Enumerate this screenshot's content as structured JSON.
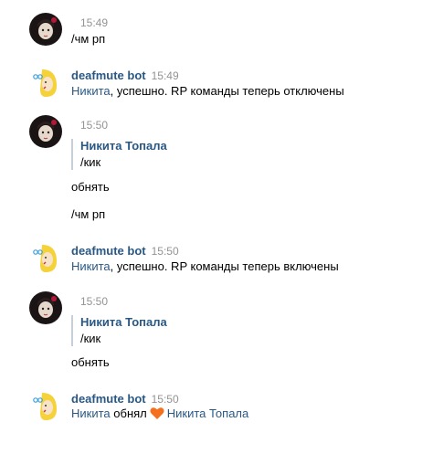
{
  "messages": [
    {
      "time": "15:49",
      "text": "/чм рп"
    },
    {
      "author": "deafmute bot",
      "time": "15:49",
      "mention": "Никита",
      "text": ", успешно. RP команды теперь отключены"
    },
    {
      "time": "15:50",
      "forward_author": "Никита Топала",
      "forward_text": "/кик",
      "lines": [
        "обнять",
        "/чм рп"
      ]
    },
    {
      "author": "deafmute bot",
      "time": "15:50",
      "mention": "Никита",
      "text": ", успешно. RP команды теперь включены"
    },
    {
      "time": "15:50",
      "forward_author": "Никита Топала",
      "forward_text": "/кик",
      "lines": [
        "обнять"
      ]
    },
    {
      "author": "deafmute bot",
      "time": "15:50",
      "mention": "Никита",
      "text": "обнял",
      "target": "Никита Топала"
    }
  ],
  "colors": {
    "link": "#2a5885",
    "time": "#939393",
    "quote_bar": "#c5d0db",
    "heart": "#f4701e"
  }
}
